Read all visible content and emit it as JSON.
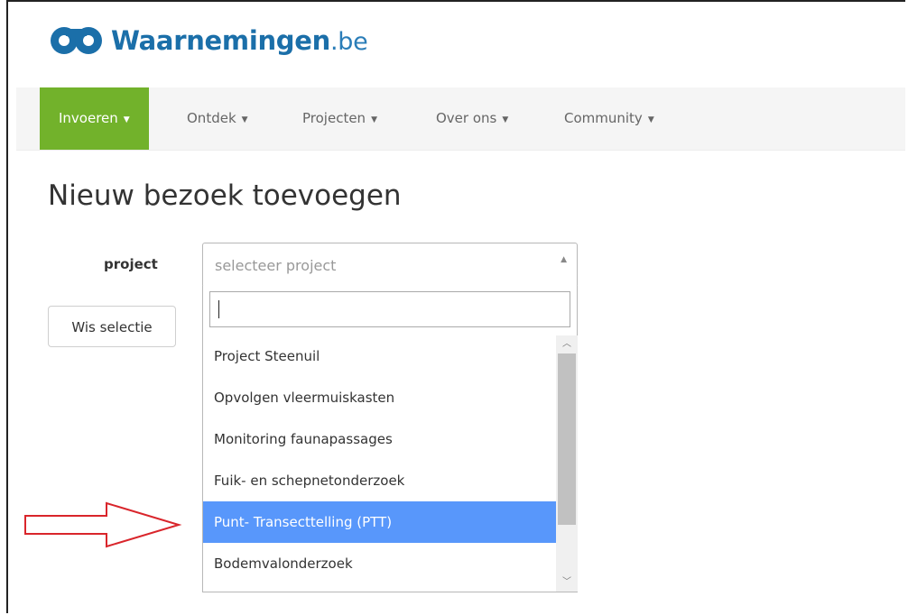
{
  "header": {
    "logo_name": "Waarnemingen",
    "logo_tld": ".be"
  },
  "nav": {
    "items": [
      {
        "label": "Invoeren",
        "active": true
      },
      {
        "label": "Ontdek",
        "active": false
      },
      {
        "label": "Projecten",
        "active": false
      },
      {
        "label": "Over ons",
        "active": false
      },
      {
        "label": "Community",
        "active": false
      }
    ],
    "caret": "▼"
  },
  "page": {
    "title": "Nieuw bezoek toevoegen"
  },
  "form": {
    "project_label": "project",
    "select_placeholder": "selecteer project",
    "clear_button": "Wis selectie",
    "search_value": ""
  },
  "dropdown": {
    "options": [
      {
        "label": "Project Steenuil",
        "highlighted": false
      },
      {
        "label": "Opvolgen vleermuiskasten",
        "highlighted": false
      },
      {
        "label": "Monitoring faunapassages",
        "highlighted": false
      },
      {
        "label": "Fuik- en schepnetonderzoek",
        "highlighted": false
      },
      {
        "label": "Punt- Transecttelling (PTT)",
        "highlighted": true
      },
      {
        "label": "Bodemvalonderzoek",
        "highlighted": false
      }
    ]
  },
  "colors": {
    "brand_blue": "#1b6fa9",
    "active_green": "#72b22b",
    "highlight_blue": "#5897fb",
    "annotation_red": "#d9252b"
  }
}
